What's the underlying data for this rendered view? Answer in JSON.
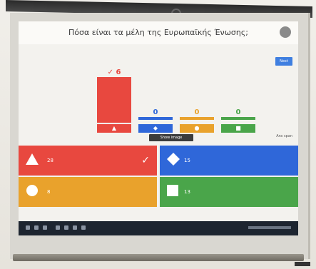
{
  "app": {
    "title": "Πόσα είναι τα μέλη της Ευρωπαϊκής Ένωσης;",
    "next_label": "Next",
    "show_image_label": "Show image",
    "side_label": "Ans span"
  },
  "results": [
    {
      "shape": "triangle",
      "color": "#e8483f",
      "count": "6",
      "correct": true
    },
    {
      "shape": "diamond",
      "color": "#2f67d9",
      "count": "0",
      "correct": false
    },
    {
      "shape": "circle",
      "color": "#e9a22c",
      "count": "0",
      "correct": false
    },
    {
      "shape": "square",
      "color": "#4aa54a",
      "count": "0",
      "correct": false
    }
  ],
  "answers": [
    {
      "shape": "triangle",
      "color": "#e8483f",
      "text": "28",
      "correct": true
    },
    {
      "shape": "diamond",
      "color": "#2f67d9",
      "text": "15",
      "correct": false
    },
    {
      "shape": "circle",
      "color": "#e9a22c",
      "text": "8",
      "correct": false
    },
    {
      "shape": "square",
      "color": "#4aa54a",
      "text": "13",
      "correct": false
    }
  ],
  "icons": {
    "check": "checkmark-icon",
    "triangle": "triangle-icon",
    "diamond": "diamond-icon",
    "circle": "circle-icon",
    "square": "square-icon"
  }
}
